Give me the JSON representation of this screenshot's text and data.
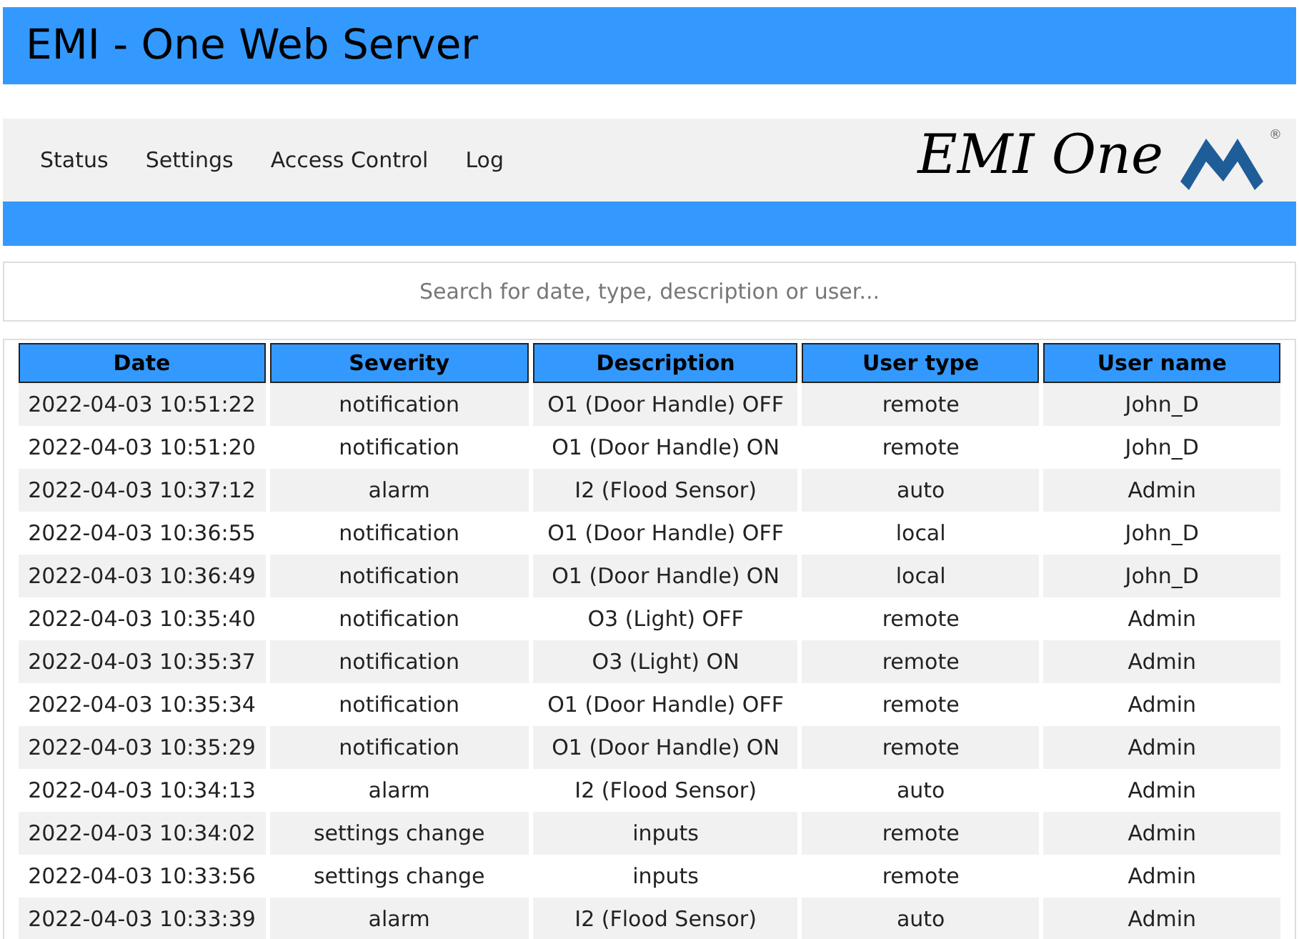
{
  "header": {
    "title": "EMI - One Web Server"
  },
  "nav": {
    "items": [
      "Status",
      "Settings",
      "Access Control",
      "Log"
    ],
    "logo_text": "EMI One",
    "logo_mark": "®"
  },
  "search": {
    "placeholder": "Search for date, type, description or user..."
  },
  "table": {
    "columns": [
      "Date",
      "Severity",
      "Description",
      "User type",
      "User name"
    ],
    "rows": [
      [
        "2022-04-03 10:51:22",
        "notification",
        "O1 (Door Handle) OFF",
        "remote",
        "John_D"
      ],
      [
        "2022-04-03 10:51:20",
        "notification",
        "O1 (Door Handle) ON",
        "remote",
        "John_D"
      ],
      [
        "2022-04-03 10:37:12",
        "alarm",
        "I2 (Flood Sensor)",
        "auto",
        "Admin"
      ],
      [
        "2022-04-03 10:36:55",
        "notification",
        "O1 (Door Handle) OFF",
        "local",
        "John_D"
      ],
      [
        "2022-04-03 10:36:49",
        "notification",
        "O1 (Door Handle) ON",
        "local",
        "John_D"
      ],
      [
        "2022-04-03 10:35:40",
        "notification",
        "O3 (Light) OFF",
        "remote",
        "Admin"
      ],
      [
        "2022-04-03 10:35:37",
        "notification",
        "O3 (Light) ON",
        "remote",
        "Admin"
      ],
      [
        "2022-04-03 10:35:34",
        "notification",
        "O1 (Door Handle) OFF",
        "remote",
        "Admin"
      ],
      [
        "2022-04-03 10:35:29",
        "notification",
        "O1 (Door Handle) ON",
        "remote",
        "Admin"
      ],
      [
        "2022-04-03 10:34:13",
        "alarm",
        "I2 (Flood Sensor)",
        "auto",
        "Admin"
      ],
      [
        "2022-04-03 10:34:02",
        "settings change",
        "inputs",
        "remote",
        "Admin"
      ],
      [
        "2022-04-03 10:33:56",
        "settings change",
        "inputs",
        "remote",
        "Admin"
      ],
      [
        "2022-04-03 10:33:39",
        "alarm",
        "I2 (Flood Sensor)",
        "auto",
        "Admin"
      ]
    ]
  }
}
